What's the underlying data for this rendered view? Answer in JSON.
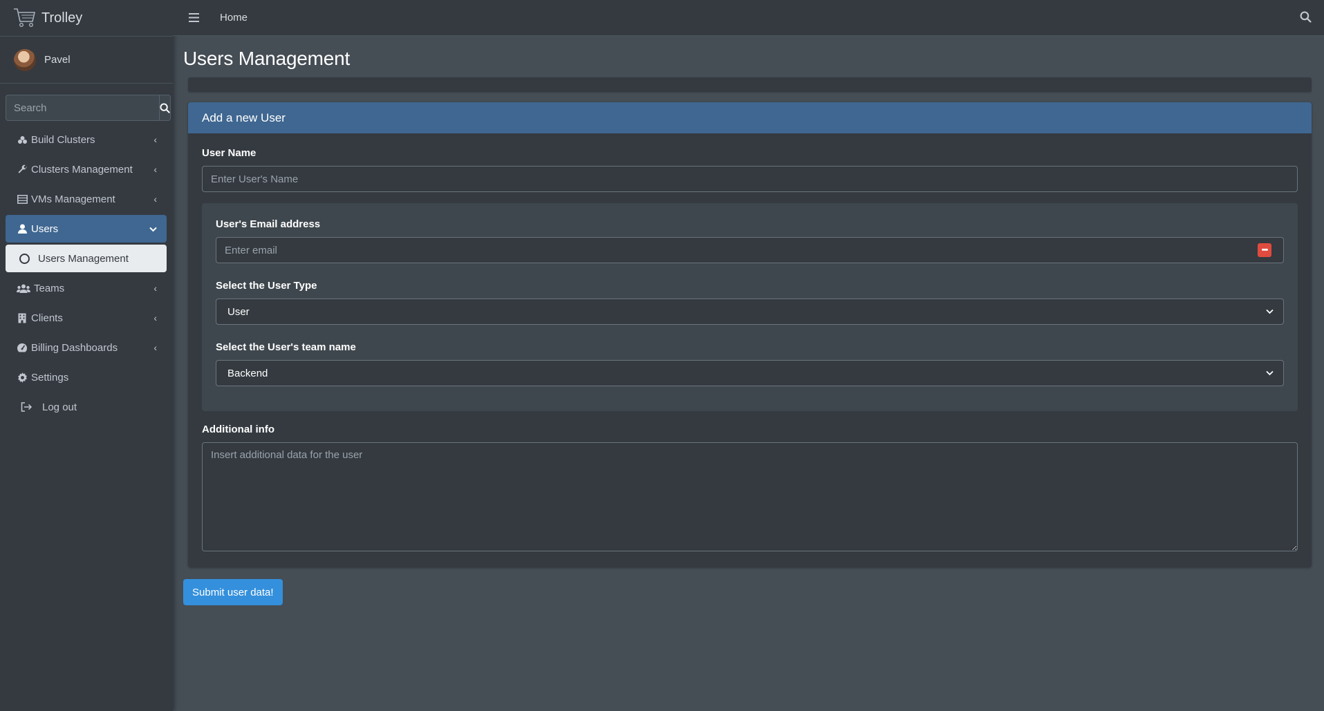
{
  "app": {
    "brand": "Trolley"
  },
  "user": {
    "name": "Pavel"
  },
  "sidebar": {
    "search_placeholder": "Search",
    "items": [
      {
        "label": "Build Clusters",
        "icon": "clusters-icon"
      },
      {
        "label": "Clusters Management",
        "icon": "wrench-icon"
      },
      {
        "label": "VMs Management",
        "icon": "server-icon"
      },
      {
        "label": "Users",
        "icon": "user-icon",
        "active": true
      },
      {
        "label": "Users Management",
        "icon": "circle-icon",
        "sub": true
      },
      {
        "label": "Teams",
        "icon": "users-icon"
      },
      {
        "label": "Clients",
        "icon": "building-icon"
      },
      {
        "label": "Billing Dashboards",
        "icon": "dashboard-icon"
      },
      {
        "label": "Settings",
        "icon": "gear-icon"
      },
      {
        "label": "Log out",
        "icon": "logout-icon"
      }
    ]
  },
  "topbar": {
    "home": "Home"
  },
  "page": {
    "title": "Users Management"
  },
  "form": {
    "header": "Add a new User",
    "username_label": "User Name",
    "username_placeholder": "Enter User's Name",
    "email_label": "User's Email address",
    "email_placeholder": "Enter email",
    "usertype_label": "Select the User Type",
    "usertype_value": "User",
    "team_label": "Select the User's team name",
    "team_value": "Backend",
    "info_label": "Additional info",
    "info_placeholder": "Insert additional data for the user",
    "submit": "Submit user data!"
  },
  "colors": {
    "accent": "#3f6791",
    "button": "#3490dc",
    "sidebar_bg": "#343a40",
    "content_bg": "#454d55"
  }
}
